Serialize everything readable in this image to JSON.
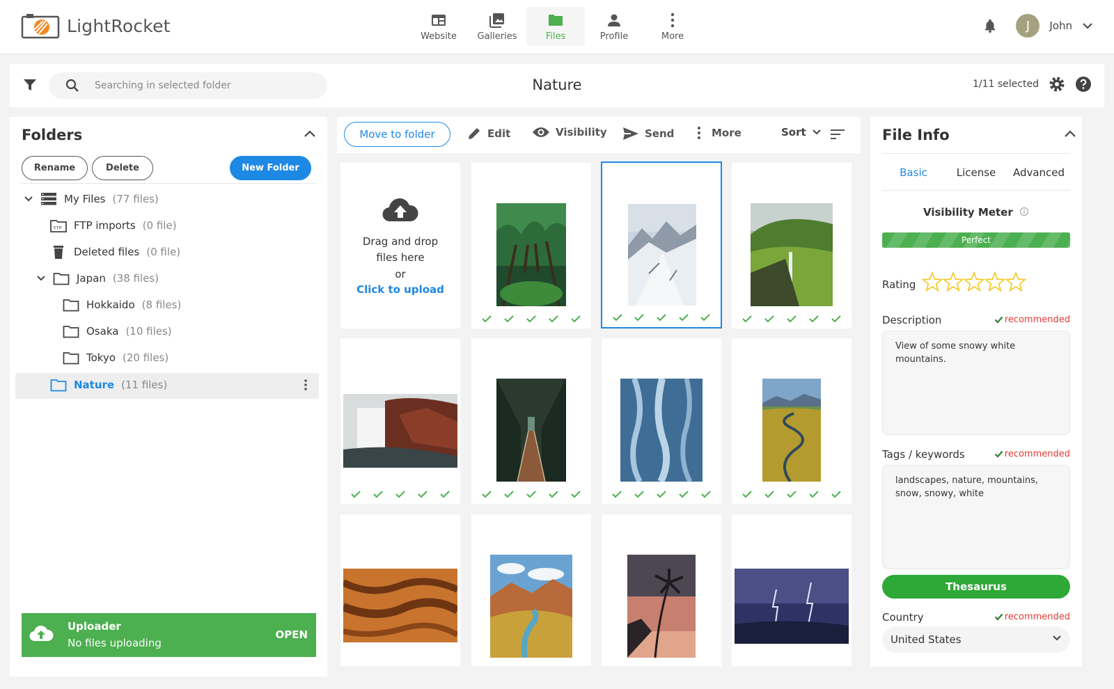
{
  "app": {
    "brand": "LightRocket",
    "accent": "#1e88e5",
    "success": "#4caf50"
  },
  "nav": {
    "items": [
      {
        "label": "Website",
        "icon": "website-icon"
      },
      {
        "label": "Galleries",
        "icon": "galleries-icon"
      },
      {
        "label": "Files",
        "icon": "folder-icon",
        "active": true
      },
      {
        "label": "Profile",
        "icon": "person-icon"
      },
      {
        "label": "More",
        "icon": "more-vertical-icon"
      }
    ],
    "user": {
      "initial": "J",
      "name": "John"
    }
  },
  "search": {
    "placeholder": "Searching in selected folder"
  },
  "current_folder": "Nature",
  "selection": "1/11 selected",
  "folders": {
    "title": "Folders",
    "buttons": {
      "rename": "Rename",
      "delete": "Delete",
      "new": "New Folder"
    },
    "tree": [
      {
        "name": "My Files",
        "count": "(77 files)"
      },
      {
        "name": "FTP imports",
        "count": "(0 file)"
      },
      {
        "name": "Deleted files",
        "count": "(0 file)"
      },
      {
        "name": "Japan",
        "count": "(38 files)"
      },
      {
        "name": "Hokkaido",
        "count": "(8 files)"
      },
      {
        "name": "Osaka",
        "count": "(10 files)"
      },
      {
        "name": "Tokyo",
        "count": "(20 files)"
      },
      {
        "name": "Nature",
        "count": "(11 files)"
      }
    ]
  },
  "uploader": {
    "title": "Uploader",
    "status": "No files uploading",
    "action": "OPEN"
  },
  "toolbar": {
    "move": "Move to folder",
    "edit": "Edit",
    "visibility": "Visibility",
    "send": "Send",
    "more": "More",
    "sort": "Sort"
  },
  "upload_card": {
    "line1": "Drag and drop",
    "line2": "files here",
    "line3": "or",
    "link": "Click to upload"
  },
  "files": [
    {
      "subject": "forest path"
    },
    {
      "subject": "snowy mountains",
      "selected": true
    },
    {
      "subject": "green waterfall cliffs"
    },
    {
      "subject": "waterfall with red rocks"
    },
    {
      "subject": "suspension bridge"
    },
    {
      "subject": "frozen blue texture"
    },
    {
      "subject": "winding river valley"
    },
    {
      "subject": "sand dunes"
    },
    {
      "subject": "canyon river"
    },
    {
      "subject": "palm tree sunset"
    },
    {
      "subject": "lightning storm"
    }
  ],
  "file_info": {
    "title": "File Info",
    "tabs": [
      "Basic",
      "License",
      "Advanced"
    ],
    "visibility_meter": {
      "label": "Visibility Meter",
      "value": "Perfect",
      "level": 1.0
    },
    "rating": {
      "label": "Rating",
      "stars": 0,
      "max": 5
    },
    "description": {
      "label": "Description",
      "badge": "recommended",
      "value": "View of some snowy white mountains."
    },
    "tags": {
      "label": "Tags / keywords",
      "badge": "recommended",
      "value": "landscapes, nature, mountains, snow, snowy, white"
    },
    "thesaurus": "Thesaurus",
    "country": {
      "label": "Country",
      "badge": "recommended",
      "value": "United States"
    }
  }
}
